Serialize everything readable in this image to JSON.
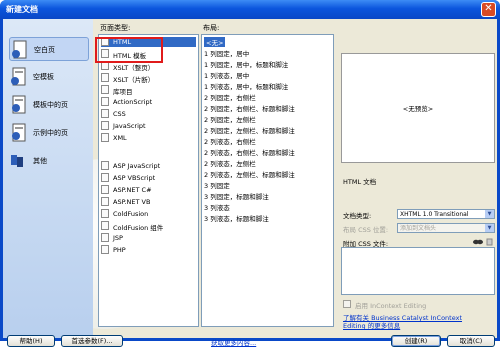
{
  "window": {
    "title": "新建文档",
    "close_icon": "close-icon"
  },
  "categories": [
    {
      "label": "空白页",
      "icon": "blank-page-icon",
      "selected": true
    },
    {
      "label": "空模板",
      "icon": "blank-template-icon",
      "selected": false
    },
    {
      "label": "模板中的页",
      "icon": "template-page-icon",
      "selected": false
    },
    {
      "label": "示例中的页",
      "icon": "sample-page-icon",
      "selected": false
    },
    {
      "label": "其他",
      "icon": "other-icon",
      "selected": false
    }
  ],
  "page_types": {
    "header": "页面类型:",
    "items": [
      "HTML",
      "HTML 模板",
      "XSLT（整页）",
      "XSLT（片断）",
      "库项目",
      "ActionScript",
      "CSS",
      "JavaScript",
      "XML",
      "ASP JavaScript",
      "ASP VBScript",
      "ASP.NET C#",
      "ASP.NET VB",
      "ColdFusion",
      "ColdFusion 组件",
      "JSP",
      "PHP"
    ]
  },
  "layouts": {
    "header": "布局:",
    "items": [
      "<无>",
      "1 列固定，居中",
      "1 列固定，居中，标题和脚注",
      "1 列液态，居中",
      "1 列液态，居中，标题和脚注",
      "2 列固定，右侧栏",
      "2 列固定，右侧栏、标题和脚注",
      "2 列固定，左侧栏",
      "2 列固定，左侧栏、标题和脚注",
      "2 列液态，右侧栏",
      "2 列液态，右侧栏、标题和脚注",
      "2 列液态，左侧栏",
      "2 列液态，左侧栏、标题和脚注",
      "3 列固定",
      "3 列固定，标题和脚注",
      "3 列液态",
      "3 列液态，标题和脚注"
    ]
  },
  "preview": {
    "text": "<无预览>",
    "description": "HTML 文档"
  },
  "doctype": {
    "label": "文档类型:",
    "value": "XHTML 1.0 Transitional"
  },
  "layout_css": {
    "label": "布局 CSS 位置:",
    "value": "添加到文档头"
  },
  "attach_css": {
    "label": "附加 CSS 文件:"
  },
  "incontext": {
    "label": "启用 InContext Editing"
  },
  "learn_more": {
    "line1": "了解有关 Business Catalyst InContext",
    "line2": "Editing 的更多信息"
  },
  "buttons": {
    "help": "帮助(H)",
    "prefs": "首选参数(F)...",
    "more_content": "获取更多内容...",
    "create": "创建(R)",
    "cancel": "取消(C)"
  }
}
